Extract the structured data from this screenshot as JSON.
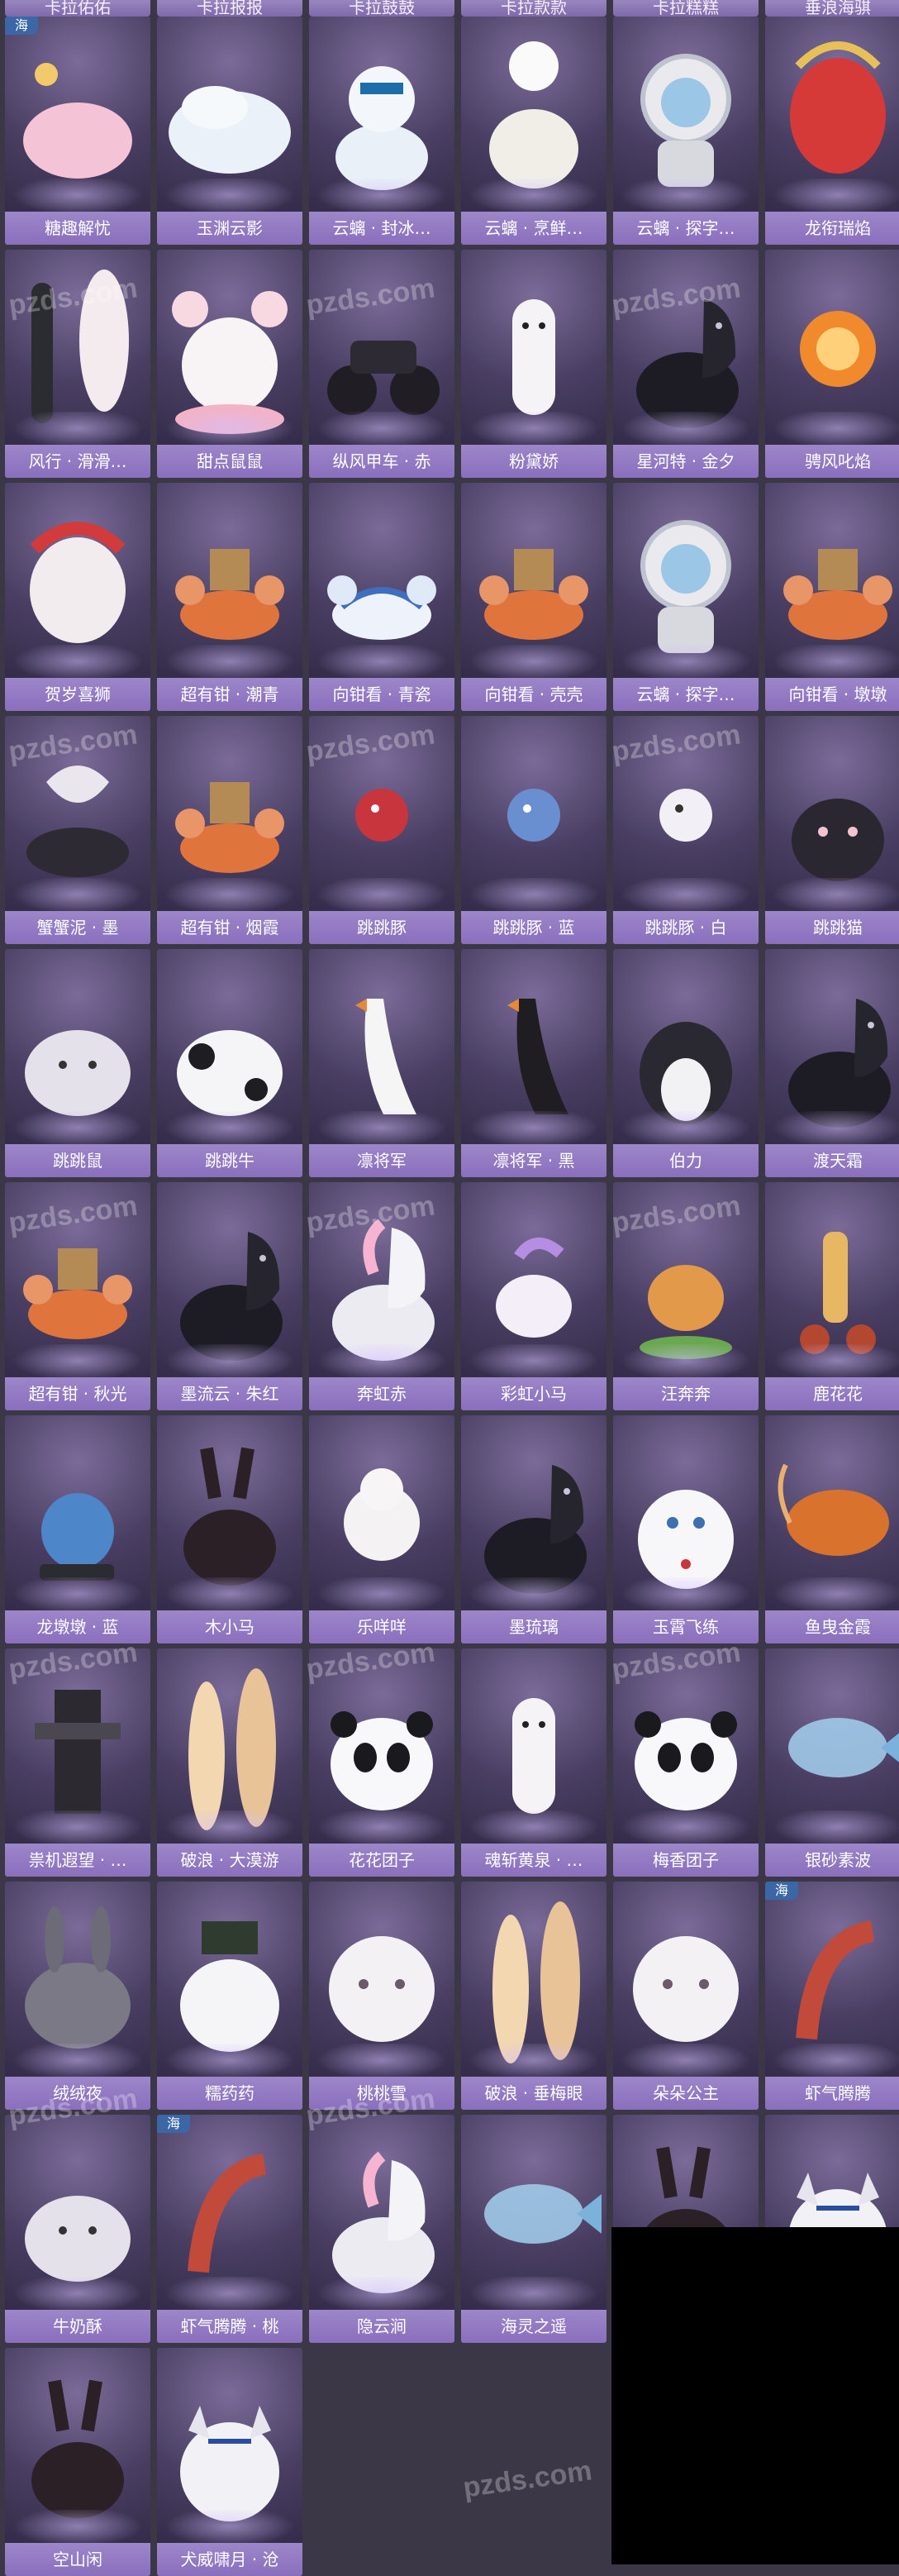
{
  "header": {
    "cells": [
      "卡拉佑佑",
      "卡拉报报",
      "卡拉鼓鼓",
      "卡拉款款",
      "卡拉糕糕",
      "垂浪海骐"
    ]
  },
  "items": [
    {
      "label": "糖趣解忧",
      "badge": "海",
      "art": "cake-hat"
    },
    {
      "label": "玉渊云影",
      "badge": "",
      "art": "cloud-mount"
    },
    {
      "label": "云螭 · 封冰…",
      "badge": "",
      "art": "snowman"
    },
    {
      "label": "云螭 · 烹鲜…",
      "badge": "",
      "art": "chef"
    },
    {
      "label": "云螭 · 探字…",
      "badge": "",
      "art": "astronaut"
    },
    {
      "label": "龙衔瑞焰",
      "badge": "",
      "art": "dragon"
    },
    {
      "label": "风行 · 滑滑…",
      "badge": "",
      "art": "skateboard"
    },
    {
      "label": "甜点鼠鼠",
      "badge": "",
      "art": "mouse"
    },
    {
      "label": "纵风甲车 · 赤",
      "badge": "",
      "art": "motorbike"
    },
    {
      "label": "粉黛娇",
      "badge": "",
      "art": "alpaca"
    },
    {
      "label": "星河特 · 金夕",
      "badge": "",
      "art": "horse-dark"
    },
    {
      "label": "骋风叱焰",
      "badge": "",
      "art": "fire"
    },
    {
      "label": "贺岁喜狮",
      "badge": "",
      "art": "lion"
    },
    {
      "label": "超有钳 · 潮青",
      "badge": "",
      "art": "crab-orange"
    },
    {
      "label": "向钳看 · 青瓷",
      "badge": "",
      "art": "crab-blue"
    },
    {
      "label": "向钳看 · 壳壳",
      "badge": "",
      "art": "crab-orange"
    },
    {
      "label": "云螭 · 探字…",
      "badge": "",
      "art": "astronaut"
    },
    {
      "label": "向钳看 · 墩墩",
      "badge": "",
      "art": "crab-orange"
    },
    {
      "label": "蟹蟹泥 · 墨",
      "badge": "",
      "art": "crab-dark"
    },
    {
      "label": "超有钳 · 烟霞",
      "badge": "",
      "art": "crab-orange"
    },
    {
      "label": "跳跳豚",
      "badge": "",
      "art": "puffer-red"
    },
    {
      "label": "跳跳豚 · 蓝",
      "badge": "",
      "art": "puffer-blue"
    },
    {
      "label": "跳跳豚 · 白",
      "badge": "",
      "art": "puffer-white"
    },
    {
      "label": "跳跳猫",
      "badge": "",
      "art": "cat-black"
    },
    {
      "label": "跳跳鼠",
      "badge": "",
      "art": "hamster"
    },
    {
      "label": "跳跳牛",
      "badge": "",
      "art": "cow"
    },
    {
      "label": "凛将军",
      "badge": "",
      "art": "goose"
    },
    {
      "label": "凛将军 · 黑",
      "badge": "",
      "art": "goose-black"
    },
    {
      "label": "伯力",
      "badge": "",
      "art": "husky"
    },
    {
      "label": "渡天霜",
      "badge": "",
      "art": "horse-dark"
    },
    {
      "label": "超有钳 · 秋光",
      "badge": "",
      "art": "crab-orange"
    },
    {
      "label": "墨流云 · 朱红",
      "badge": "",
      "art": "horse-dark"
    },
    {
      "label": "奔虹赤",
      "badge": "",
      "art": "horse-white"
    },
    {
      "label": "彩虹小马",
      "badge": "",
      "art": "pony"
    },
    {
      "label": "汪奔奔",
      "badge": "",
      "art": "dog"
    },
    {
      "label": "鹿花花",
      "badge": "",
      "art": "deer"
    },
    {
      "label": "龙墩墩 · 蓝",
      "badge": "",
      "art": "dragon-toy"
    },
    {
      "label": "木小马",
      "badge": "",
      "art": "donkey"
    },
    {
      "label": "乐咩咩",
      "badge": "",
      "art": "sheep"
    },
    {
      "label": "墨琉璃",
      "badge": "",
      "art": "horse-dark"
    },
    {
      "label": "玉霄飞练",
      "badge": "",
      "art": "cat-white"
    },
    {
      "label": "鱼曳金霞",
      "badge": "",
      "art": "koi"
    },
    {
      "label": "祟机遐望 · …",
      "badge": "",
      "art": "mech"
    },
    {
      "label": "破浪 · 大漠游",
      "badge": "",
      "art": "surfboard"
    },
    {
      "label": "花花团子",
      "badge": "",
      "art": "panda"
    },
    {
      "label": "魂斩黄泉 · …",
      "badge": "",
      "art": "alpaca"
    },
    {
      "label": "梅香团子",
      "badge": "",
      "art": "panda"
    },
    {
      "label": "银砂素波",
      "badge": "",
      "art": "fish"
    },
    {
      "label": "绒绒夜",
      "badge": "",
      "art": "bunny"
    },
    {
      "label": "糯药药",
      "badge": "",
      "art": "bear"
    },
    {
      "label": "桃桃雪",
      "badge": "",
      "art": "fluffy"
    },
    {
      "label": "破浪 · 垂梅眼",
      "badge": "",
      "art": "surfboard"
    },
    {
      "label": "朵朵公主",
      "badge": "",
      "art": "fluffy"
    },
    {
      "label": "虾气腾腾",
      "badge": "海",
      "art": "shrimp"
    },
    {
      "label": "牛奶酥",
      "badge": "",
      "art": "hamster"
    },
    {
      "label": "虾气腾腾 · 桃",
      "badge": "海",
      "art": "shrimp"
    },
    {
      "label": "隐云涧",
      "badge": "",
      "art": "horse-white"
    },
    {
      "label": "海灵之遥",
      "badge": "",
      "art": "fish"
    },
    {
      "label": "",
      "badge": "",
      "art": "donkey"
    },
    {
      "label": "",
      "badge": "",
      "art": "wolf"
    },
    {
      "label": "空山闲",
      "badge": "",
      "art": "donkey"
    },
    {
      "label": "犬威啸月 · 沧",
      "badge": "",
      "art": "wolf"
    }
  ],
  "watermark": "pzds.com",
  "colors": {
    "label_bg": "#9d86c9",
    "page_bg": "#3c3747",
    "badge_bg": "#3b67a7"
  }
}
